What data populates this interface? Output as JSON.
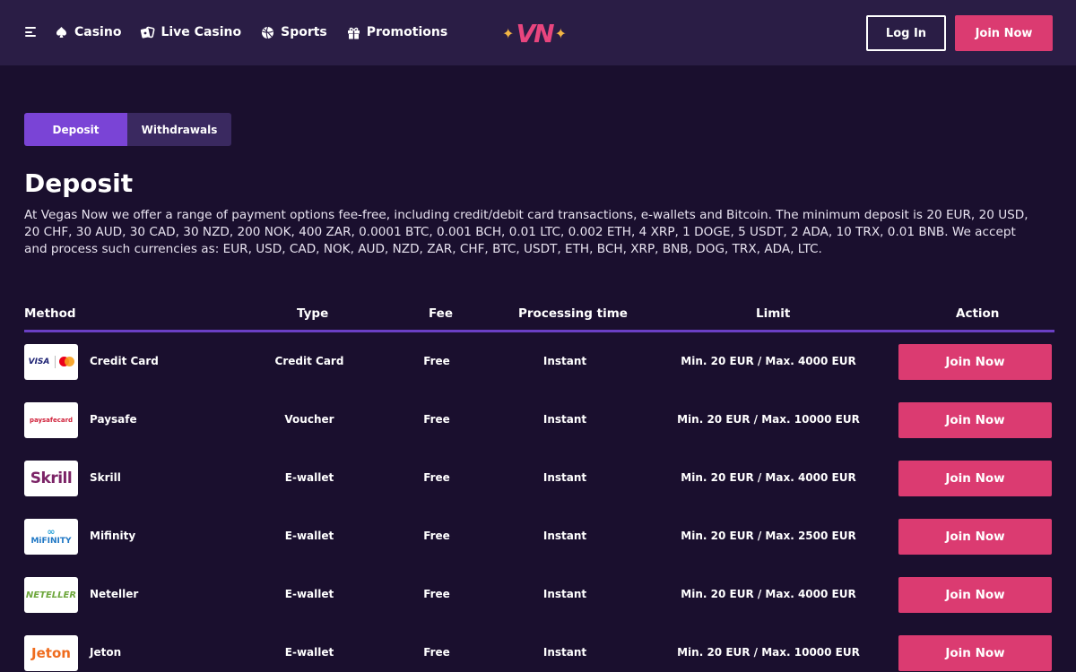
{
  "header": {
    "nav": [
      {
        "label": "Casino",
        "icon": "casino-icon"
      },
      {
        "label": "Live Casino",
        "icon": "live-casino-icon"
      },
      {
        "label": "Sports",
        "icon": "sports-icon"
      },
      {
        "label": "Promotions",
        "icon": "promotions-icon"
      }
    ],
    "logo": {
      "text": "VN",
      "star": "✦"
    },
    "login_label": "Log In",
    "join_label": "Join Now"
  },
  "tabs": [
    {
      "label": "Deposit",
      "active": true
    },
    {
      "label": "Withdrawals",
      "active": false
    }
  ],
  "main": {
    "title": "Deposit",
    "description": "At Vegas Now we offer a range of payment options fee-free, including credit/debit card transactions, e-wallets and Bitcoin. The minimum deposit is 20 EUR, 20 USD, 20 CHF, 30 AUD, 30 CAD, 30 NZD, 200 NOK, 400 ZAR, 0.0001 BTC, 0.001 BCH, 0.01 LTC, 0.002 ETH, 4 XRP, 1 DOGE, 5 USDT, 2 ADA, 10 TRX, 0.01 BNB. We accept and process such currencies as: EUR, USD, CAD, NOK, AUD, NZD, ZAR, CHF, BTC, USDT, ETH, BCH, XRP, BNB, DOG, TRX, ADA, LTC."
  },
  "table": {
    "columns": {
      "method": "Method",
      "type": "Type",
      "fee": "Fee",
      "processing": "Processing time",
      "limit": "Limit",
      "action": "Action"
    },
    "rows": [
      {
        "name": "Credit Card",
        "type": "Credit Card",
        "fee": "Free",
        "processing": "Instant",
        "limit": "Min. 20 EUR / Max. 4000 EUR",
        "action": "Join Now",
        "logo": "visa-mastercard-logo",
        "logo_text": "VISA"
      },
      {
        "name": "Paysafe",
        "type": "Voucher",
        "fee": "Free",
        "processing": "Instant",
        "limit": "Min. 20 EUR / Max. 10000 EUR",
        "action": "Join Now",
        "logo": "paysafecard-logo",
        "logo_text": "paysafecard"
      },
      {
        "name": "Skrill",
        "type": "E-wallet",
        "fee": "Free",
        "processing": "Instant",
        "limit": "Min. 20 EUR / Max. 4000 EUR",
        "action": "Join Now",
        "logo": "skrill-logo",
        "logo_text": "Skrill"
      },
      {
        "name": "Mifinity",
        "type": "E-wallet",
        "fee": "Free",
        "processing": "Instant",
        "limit": "Min. 20 EUR / Max. 2500 EUR",
        "action": "Join Now",
        "logo": "mifinity-logo",
        "logo_text": "MiFINITY"
      },
      {
        "name": "Neteller",
        "type": "E-wallet",
        "fee": "Free",
        "processing": "Instant",
        "limit": "Min. 20 EUR / Max. 4000 EUR",
        "action": "Join Now",
        "logo": "neteller-logo",
        "logo_text": "NETELLER"
      },
      {
        "name": "Jeton",
        "type": "E-wallet",
        "fee": "Free",
        "processing": "Instant",
        "limit": "Min. 20 EUR / Max. 10000 EUR",
        "action": "Join Now",
        "logo": "jeton-logo",
        "logo_text": "Jeton"
      }
    ]
  },
  "colors": {
    "background": "#1a0f2e",
    "header": "#2a1d45",
    "accent_pink": "#db3b71",
    "accent_purple": "#7a44d6"
  }
}
